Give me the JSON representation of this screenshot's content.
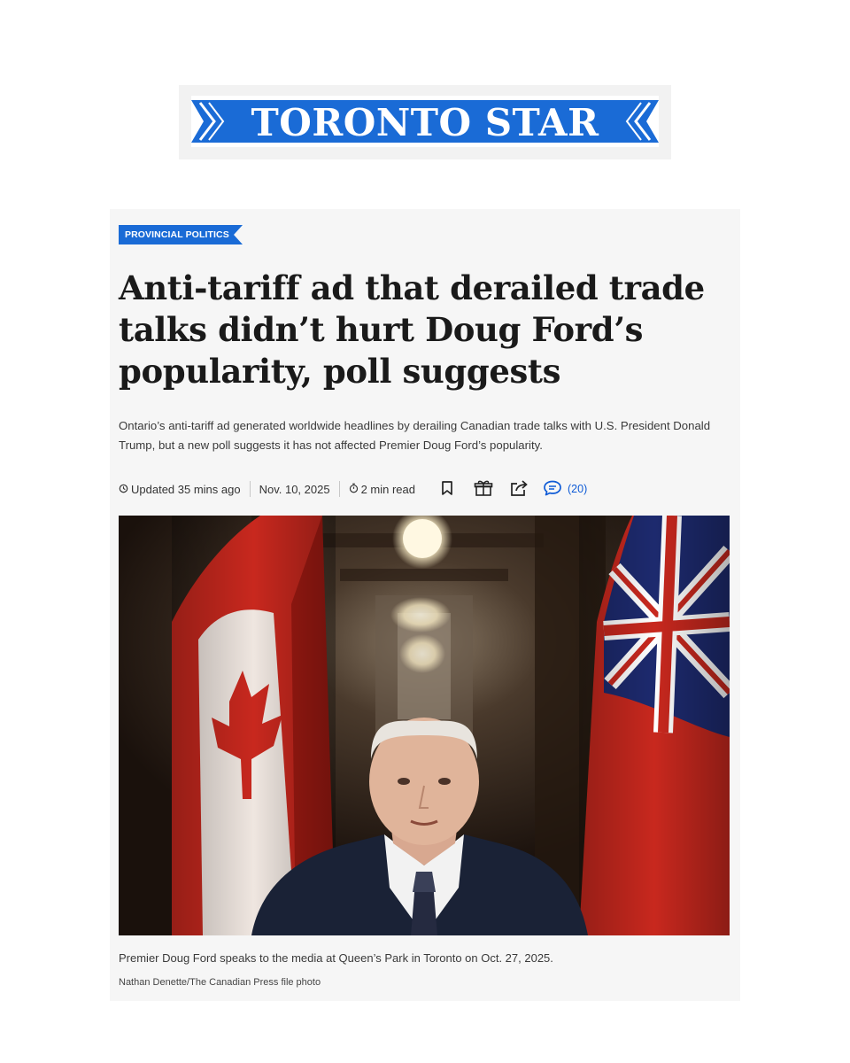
{
  "masthead": {
    "brand": "TORONTO STAR",
    "brand_color": "#1a6bd6"
  },
  "article": {
    "section": "PROVINCIAL POLITICS",
    "section_color": "#1a6bd6",
    "headline": "Anti-tariff ad that derailed trade talks didn’t hurt Doug Ford’s popularity, poll suggests",
    "dek": "Ontario’s anti-tariff ad generated worldwide headlines by derailing Canadian trade talks with U.S. President Donald Trump, but a new poll suggests it has not affected Premier Doug Ford’s popularity.",
    "meta": {
      "updated": "Updated 35 mins ago",
      "date": "Nov. 10, 2025",
      "read_time": "2 min read",
      "comment_count": "(20)",
      "icons": [
        "clock-icon",
        "timer-icon",
        "bookmark-icon",
        "gift-icon",
        "share-icon",
        "comment-icon"
      ]
    },
    "photo": {
      "caption": "Premier Doug Ford speaks to the media at Queen’s Park in Toronto on Oct. 27, 2025.",
      "credit": "Nathan Denette/The Canadian Press file photo"
    }
  }
}
